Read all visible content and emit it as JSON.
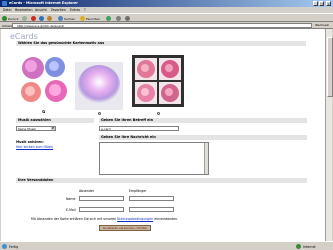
{
  "window": {
    "title": "eCards - Microsoft Internet Explorer"
  },
  "menu": [
    "Datei",
    "Bearbeiten",
    "Ansicht",
    "Favoriten",
    "Extras",
    "?"
  ],
  "toolbar": {
    "back": "Zurück",
    "search": "Suchen",
    "favorites": "Favoriten",
    "history": "Verlauf"
  },
  "address": {
    "label": "Adresse",
    "url": "http://www.ecs-gmbh.de/ecard/",
    "go": "Wechseln zu"
  },
  "page": {
    "heading": "eCards",
    "motif_section": "Wählen Sie das gewünschte Kartenmotiv aus",
    "music_section": "Musik auswählen",
    "music_value": "Keine Musik",
    "music_preview_label": "Musik anhören:",
    "music_preview_link": "Hier klicken zum Hören",
    "subject_section": "Geben Sie Ihren Betreff ein",
    "subject_value": "e-card",
    "message_section": "Geben Sie Ihre Nachricht ein",
    "address_section": "Ihre Versanddaten",
    "sender_label": "Absender",
    "recipient_label": "Empfänger",
    "name_label": "Name",
    "email_label": "E-Mail",
    "legal_prefix": "Mit Absenden der Karte erklären Sie sich mit unseren",
    "legal_link": "Nutzungsbedingungen",
    "legal_suffix": "einverstanden.",
    "submit": "Grußkarte versenden / Prüfen"
  },
  "status": {
    "left": "Fertig",
    "right": "Internet"
  }
}
